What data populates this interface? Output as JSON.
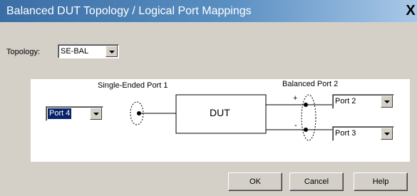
{
  "window": {
    "title": "Balanced DUT Topology / Logical Port Mappings",
    "close_glyph": "X"
  },
  "topology": {
    "label": "Topology:",
    "value": "SE-BAL"
  },
  "diagram": {
    "single_ended_label": "Single-Ended Port 1",
    "balanced_label": "Balanced Port 2",
    "dut_label": "DUT",
    "plus": "+",
    "minus": "-",
    "single_ended_port": "Port 4",
    "balanced_plus_port": "Port 2",
    "balanced_minus_port": "Port 3"
  },
  "buttons": {
    "ok": "OK",
    "cancel": "Cancel",
    "help": "Help"
  }
}
